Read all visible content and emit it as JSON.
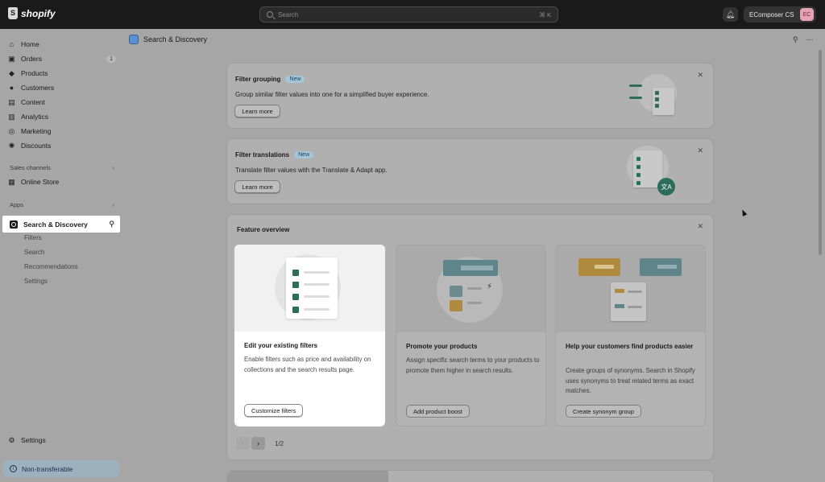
{
  "topbar": {
    "logo_text": "shopify",
    "search_placeholder": "Search",
    "search_shortcut": "⌘ K",
    "store_name": "EComposer CS",
    "avatar_initials": "EC"
  },
  "sidebar": {
    "items": [
      {
        "label": "Home",
        "icon": "home-icon"
      },
      {
        "label": "Orders",
        "icon": "orders-icon",
        "count": "1"
      },
      {
        "label": "Products",
        "icon": "tag-icon"
      },
      {
        "label": "Customers",
        "icon": "person-icon"
      },
      {
        "label": "Content",
        "icon": "content-icon"
      },
      {
        "label": "Analytics",
        "icon": "chart-icon"
      },
      {
        "label": "Marketing",
        "icon": "marketing-icon"
      },
      {
        "label": "Discounts",
        "icon": "discount-icon"
      }
    ],
    "sales_channels_label": "Sales channels",
    "online_store_label": "Online Store",
    "apps_label": "Apps",
    "active_app_label": "Search & Discovery",
    "sub_items": [
      "Filters",
      "Search",
      "Recommendations",
      "Settings"
    ],
    "settings_label": "Settings",
    "non_transferable_label": "Non-transferable"
  },
  "main": {
    "page_title": "Search & Discovery",
    "banners": [
      {
        "title": "Filter grouping",
        "badge": "New",
        "text": "Group similar filter values into one for a simplified buyer experience.",
        "button": "Learn more"
      },
      {
        "title": "Filter translations",
        "badge": "New",
        "text": "Translate filter values with the Translate & Adapt app.",
        "button": "Learn more"
      }
    ],
    "feature_overview": {
      "title": "Feature overview",
      "cards": [
        {
          "title": "Edit your existing filters",
          "description": "Enable filters such as price and availability on collections and the search results page.",
          "button": "Customize filters"
        },
        {
          "title": "Promote your products",
          "description": "Assign specific search terms to your products to promote them higher in search results.",
          "button": "Add product boost"
        },
        {
          "title": "Help your customers find products easier",
          "description": "Create groups of synonyms. Search in Shopify uses synonyms to treat related terms as exact matches.",
          "button": "Create synonym group"
        }
      ],
      "pagination": "1/2"
    }
  },
  "colors": {
    "accent_green": "#2d6e5a",
    "topbar_bg": "#1a1a1a",
    "badge_bg": "#a4c6d8"
  }
}
